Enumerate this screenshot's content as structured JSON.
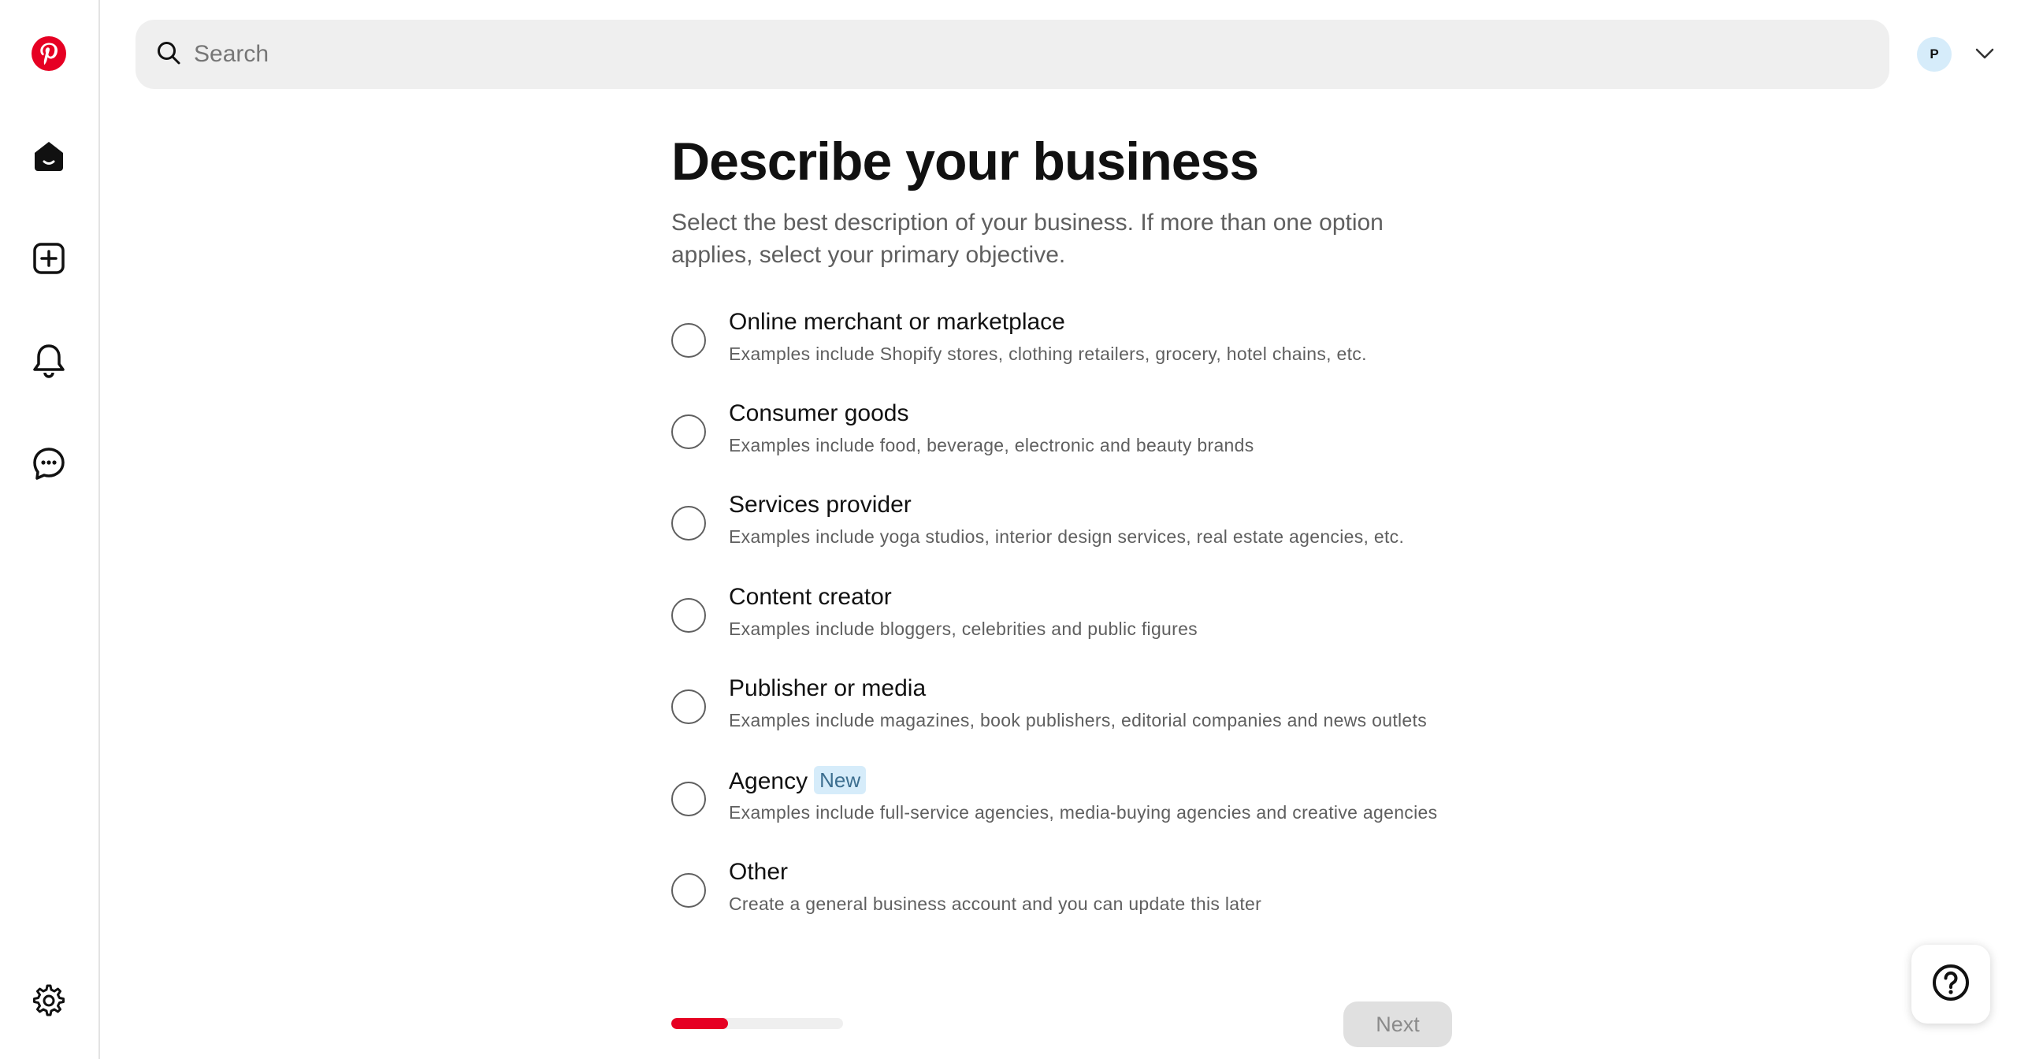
{
  "header": {
    "search_placeholder": "Search",
    "avatar_initial": "P"
  },
  "sidebar": {
    "items": [
      {
        "name": "pinterest-logo",
        "icon": "pinterest-logo-icon"
      },
      {
        "name": "home",
        "icon": "home-icon"
      },
      {
        "name": "create",
        "icon": "plus-square-icon"
      },
      {
        "name": "notifications",
        "icon": "bell-icon"
      },
      {
        "name": "messages",
        "icon": "chat-bubble-icon"
      },
      {
        "name": "settings",
        "icon": "gear-icon"
      }
    ],
    "brand_color": "#e60023"
  },
  "main": {
    "title": "Describe your business",
    "subtitle": "Select the best description of your business. If more than one option applies, select your primary objective.",
    "options": [
      {
        "label": "Online merchant or marketplace",
        "description": "Examples include Shopify stores, clothing retailers, grocery, hotel chains, etc.",
        "badge": ""
      },
      {
        "label": "Consumer goods",
        "description": "Examples include food, beverage, electronic and beauty brands",
        "badge": ""
      },
      {
        "label": "Services provider",
        "description": "Examples include yoga studios, interior design services, real estate agencies, etc.",
        "badge": ""
      },
      {
        "label": "Content creator",
        "description": "Examples include bloggers, celebrities and public figures",
        "badge": ""
      },
      {
        "label": "Publisher or media",
        "description": "Examples include magazines, book publishers, editorial companies and news outlets",
        "badge": ""
      },
      {
        "label": "Agency",
        "description": "Examples include full-service agencies, media-buying agencies and creative agencies",
        "badge": "New"
      },
      {
        "label": "Other",
        "description": "Create a general business account and you can update this later",
        "badge": ""
      }
    ]
  },
  "footer": {
    "progress_fraction": 0.33,
    "next_label": "Next",
    "help_icon": "question-circle-icon"
  }
}
